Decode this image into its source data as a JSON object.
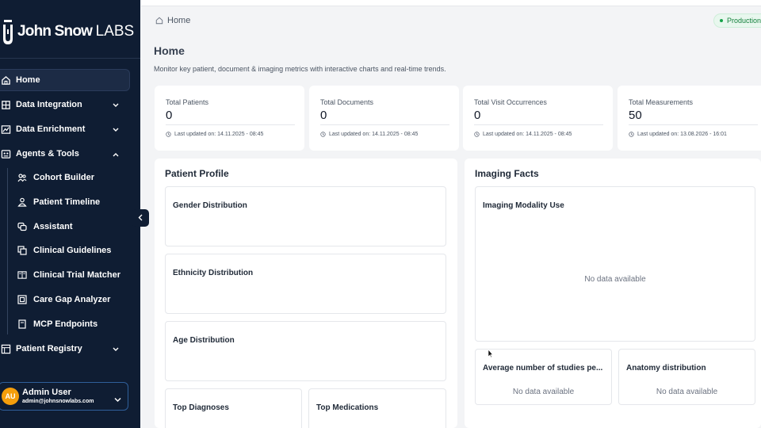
{
  "brand": {
    "name": "John Snow",
    "suffix": "LABS"
  },
  "sidebar": {
    "items": [
      {
        "label": "Home",
        "icon": "home-icon",
        "active": true
      },
      {
        "label": "Data Integration",
        "icon": "data-integration-icon",
        "expandable": true,
        "expanded": false
      },
      {
        "label": "Data Enrichment",
        "icon": "chart-line-icon",
        "expandable": true,
        "expanded": false
      },
      {
        "label": "Agents & Tools",
        "icon": "agents-icon",
        "expandable": true,
        "expanded": true
      }
    ],
    "sub_items": [
      {
        "label": "Cohort Builder",
        "icon": "cohort-icon"
      },
      {
        "label": "Patient Timeline",
        "icon": "person-icon"
      },
      {
        "label": "Assistant",
        "icon": "chat-icon"
      },
      {
        "label": "Clinical Guidelines",
        "icon": "copy-icon"
      },
      {
        "label": "Clinical Trial Matcher",
        "icon": "book-icon"
      },
      {
        "label": "Care Gap Analyzer",
        "icon": "analyzer-icon"
      },
      {
        "label": "MCP Endpoints",
        "icon": "document-icon"
      }
    ],
    "registry": {
      "label": "Patient Registry",
      "icon": "registry-icon"
    },
    "user": {
      "initials": "AU",
      "name": "Admin User",
      "email": "admin@johnsnowlabs.com"
    }
  },
  "header": {
    "breadcrumb": "Home",
    "environment": "Production",
    "title": "Home",
    "subtitle": "Monitor key patient, document & imaging metrics with interactive charts and real-time trends."
  },
  "stats": [
    {
      "label": "Total Patients",
      "value": "0",
      "updated": "Last updated on: 14.11.2025 - 08:45"
    },
    {
      "label": "Total Documents",
      "value": "0",
      "updated": "Last updated on: 14.11.2025 - 08:45"
    },
    {
      "label": "Total Visit Occurrences",
      "value": "0",
      "updated": "Last updated on: 14.11.2025 - 08:45"
    },
    {
      "label": "Total Measurements",
      "value": "50",
      "updated": "Last updated on: 13.08.2026 - 16:01"
    }
  ],
  "patient_profile": {
    "title": "Patient Profile",
    "cards": [
      "Gender Distribution",
      "Ethnicity Distribution",
      "Age Distribution",
      "Top Diagnoses",
      "Top Medications"
    ]
  },
  "imaging_facts": {
    "title": "Imaging Facts",
    "cards": [
      "Imaging Modality Use",
      "Average number of studies pe...",
      "Anatomy distribution"
    ],
    "no_data": "No data available"
  },
  "colors": {
    "sidebar_bg": "#0f1d33",
    "accent_green": "#16a34a",
    "avatar": "#f59e0b"
  }
}
